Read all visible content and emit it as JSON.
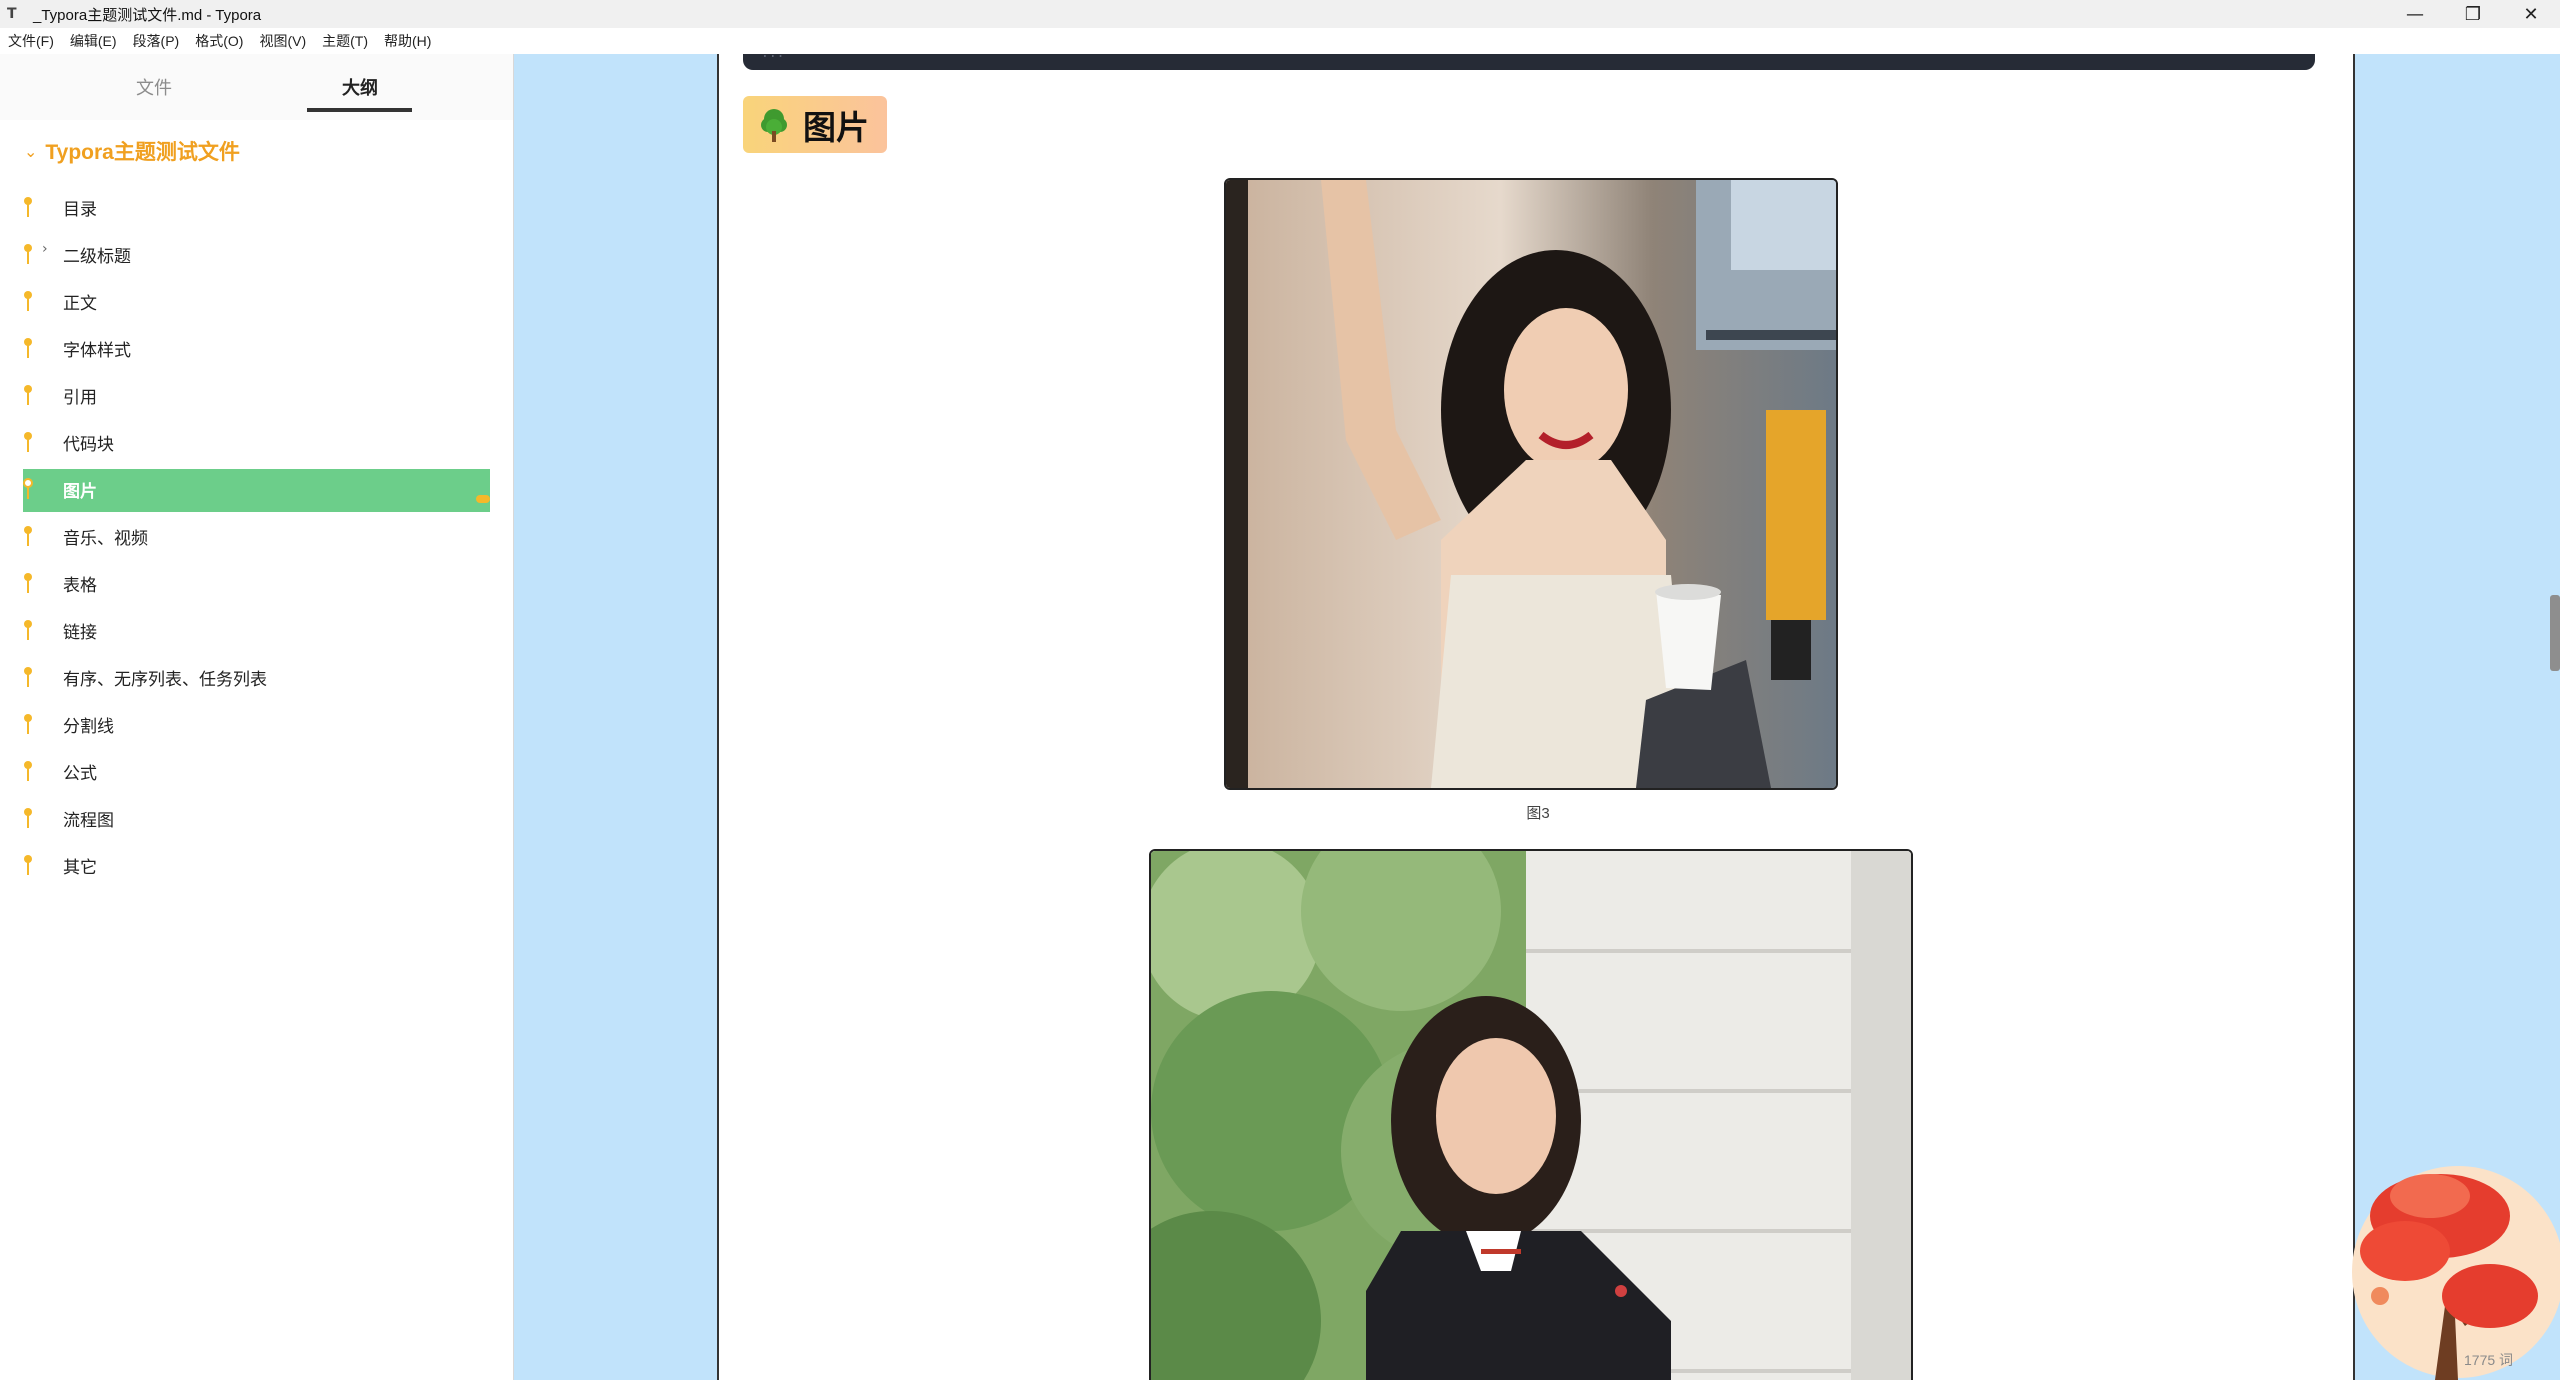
{
  "window": {
    "app_icon": "T",
    "title": "_Typora主题测试文件.md - Typora",
    "minimize": "—",
    "maximize": "❐",
    "close": "✕"
  },
  "menu": [
    "文件(F)",
    "编辑(E)",
    "段落(P)",
    "格式(O)",
    "视图(V)",
    "主题(T)",
    "帮助(H)"
  ],
  "sidebar": {
    "tabs": {
      "files": "文件",
      "outline": "大纲"
    },
    "active_tab": "outline",
    "root": {
      "chevron": "⌄",
      "label": "Typora主题测试文件"
    },
    "items": [
      {
        "label": "目录"
      },
      {
        "label": "二级标题",
        "expander": "›"
      },
      {
        "label": "正文"
      },
      {
        "label": "字体样式"
      },
      {
        "label": "引用"
      },
      {
        "label": "代码块"
      },
      {
        "label": "图片",
        "active": true
      },
      {
        "label": "音乐、视频"
      },
      {
        "label": "表格"
      },
      {
        "label": "链接"
      },
      {
        "label": "有序、无序列表、任务列表"
      },
      {
        "label": "分割线"
      },
      {
        "label": "公式"
      },
      {
        "label": "流程图"
      },
      {
        "label": "其它"
      }
    ],
    "footer": {
      "back_icon": "‹",
      "source_icon": "</>"
    }
  },
  "document": {
    "code_fragment": "...",
    "heading": "图片",
    "heading_icon": "tree-icon",
    "figure_caption": "图3",
    "word_count": "1775 词"
  },
  "colors": {
    "accent": "#f0a020",
    "active_outline": "#6cce8a",
    "canvas": "#c1e3fb",
    "heading_gradient": [
      "#f9d47a",
      "#fbc39c"
    ]
  }
}
